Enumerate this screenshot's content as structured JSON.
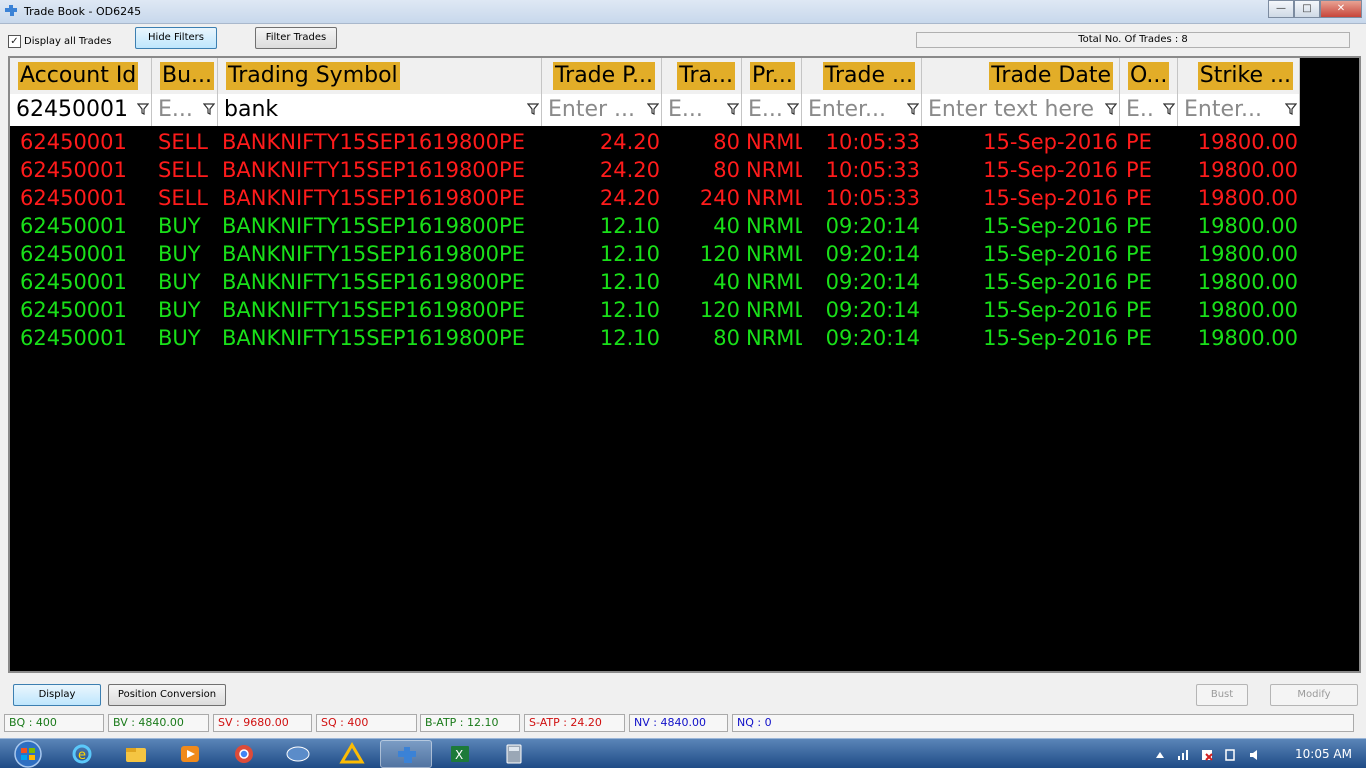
{
  "window": {
    "title": "Trade Book - OD6245",
    "minimize": "—",
    "maximize": "□",
    "close": "✕"
  },
  "toolbar": {
    "display_all_label": "Display all Trades",
    "checkbox_mark": "✓",
    "hide_filters": "Hide Filters",
    "filter_trades": "Filter Trades",
    "total_trades": "Total No. Of Trades : 8"
  },
  "columns": [
    {
      "header": "Account Id",
      "filter": "62450001",
      "filter_is_placeholder": false
    },
    {
      "header": "Bu...",
      "filter": "E...",
      "filter_is_placeholder": true
    },
    {
      "header": "Trading Symbol",
      "filter": "bank",
      "filter_is_placeholder": false
    },
    {
      "header": "Trade P...",
      "filter": "Enter ...",
      "filter_is_placeholder": true
    },
    {
      "header": "Tra...",
      "filter": "E...",
      "filter_is_placeholder": true
    },
    {
      "header": "Pr...",
      "filter": "E...",
      "filter_is_placeholder": true
    },
    {
      "header": "Trade ...",
      "filter": "Enter...",
      "filter_is_placeholder": true
    },
    {
      "header": "Trade Date",
      "filter": "Enter text here",
      "filter_is_placeholder": true
    },
    {
      "header": "O...",
      "filter": "E..",
      "filter_is_placeholder": true
    },
    {
      "header": "Strike ...",
      "filter": "Enter...",
      "filter_is_placeholder": true
    }
  ],
  "trades": [
    {
      "side": "sell",
      "cells": [
        "62450001",
        "SELL",
        "BANKNIFTY15SEP1619800PE",
        "24.20",
        "80",
        "NRML",
        "10:05:33",
        "15-Sep-2016",
        "PE",
        "19800.00"
      ]
    },
    {
      "side": "sell",
      "cells": [
        "62450001",
        "SELL",
        "BANKNIFTY15SEP1619800PE",
        "24.20",
        "80",
        "NRML",
        "10:05:33",
        "15-Sep-2016",
        "PE",
        "19800.00"
      ]
    },
    {
      "side": "sell",
      "cells": [
        "62450001",
        "SELL",
        "BANKNIFTY15SEP1619800PE",
        "24.20",
        "240",
        "NRML",
        "10:05:33",
        "15-Sep-2016",
        "PE",
        "19800.00"
      ]
    },
    {
      "side": "buy",
      "cells": [
        "62450001",
        "BUY",
        "BANKNIFTY15SEP1619800PE",
        "12.10",
        "40",
        "NRML",
        "09:20:14",
        "15-Sep-2016",
        "PE",
        "19800.00"
      ]
    },
    {
      "side": "buy",
      "cells": [
        "62450001",
        "BUY",
        "BANKNIFTY15SEP1619800PE",
        "12.10",
        "120",
        "NRML",
        "09:20:14",
        "15-Sep-2016",
        "PE",
        "19800.00"
      ]
    },
    {
      "side": "buy",
      "cells": [
        "62450001",
        "BUY",
        "BANKNIFTY15SEP1619800PE",
        "12.10",
        "40",
        "NRML",
        "09:20:14",
        "15-Sep-2016",
        "PE",
        "19800.00"
      ]
    },
    {
      "side": "buy",
      "cells": [
        "62450001",
        "BUY",
        "BANKNIFTY15SEP1619800PE",
        "12.10",
        "120",
        "NRML",
        "09:20:14",
        "15-Sep-2016",
        "PE",
        "19800.00"
      ]
    },
    {
      "side": "buy",
      "cells": [
        "62450001",
        "BUY",
        "BANKNIFTY15SEP1619800PE",
        "12.10",
        "80",
        "NRML",
        "09:20:14",
        "15-Sep-2016",
        "PE",
        "19800.00"
      ]
    }
  ],
  "actions": {
    "display": "Display",
    "position_conversion": "Position Conversion",
    "bust": "Bust",
    "modify": "Modify"
  },
  "status": [
    {
      "text": "BQ : 400",
      "color": "#1a7a1a"
    },
    {
      "text": "BV : 4840.00",
      "color": "#1a7a1a"
    },
    {
      "text": "SV : 9680.00",
      "color": "#d01010"
    },
    {
      "text": "SQ : 400",
      "color": "#d01010"
    },
    {
      "text": "B-ATP : 12.10",
      "color": "#1a7a1a"
    },
    {
      "text": "S-ATP : 24.20",
      "color": "#d01010"
    },
    {
      "text": "NV : 4840.00",
      "color": "#1010c8"
    },
    {
      "text": "NQ : 0",
      "color": "#1010c8"
    }
  ],
  "colors": {
    "sell": "#ff1b1b",
    "buy": "#19e019",
    "header_highlight": "#e2ad28",
    "grid_bg": "#000000"
  },
  "taskbar": {
    "items": [
      "ie-icon",
      "explorer-icon",
      "media-player-icon",
      "chrome-icon",
      "app-icon",
      "drive-icon",
      "trade-app-icon",
      "excel-icon",
      "calculator-icon"
    ],
    "clock": "10:05 AM"
  }
}
